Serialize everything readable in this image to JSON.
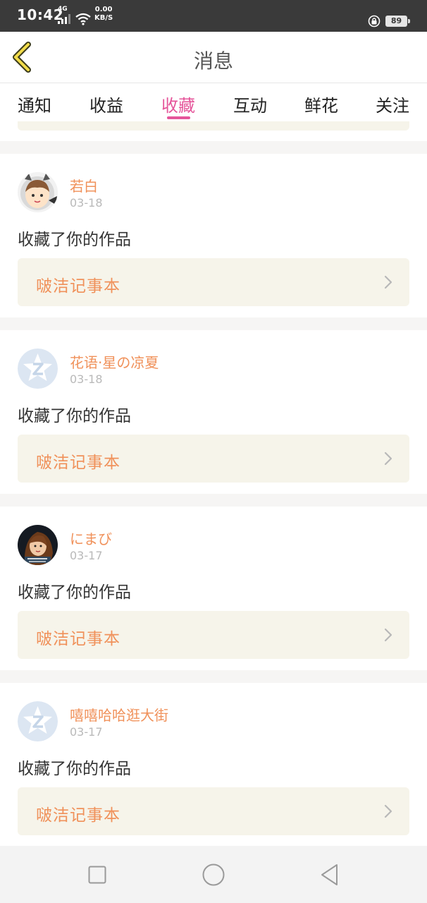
{
  "status_bar": {
    "time": "10:42",
    "network": "4G",
    "speed_value": "0.00",
    "speed_unit": "KB/S",
    "battery": "89"
  },
  "header": {
    "title": "消息"
  },
  "tabs": [
    {
      "label": "通知",
      "active": false
    },
    {
      "label": "收益",
      "active": false
    },
    {
      "label": "收藏",
      "active": true
    },
    {
      "label": "互动",
      "active": false
    },
    {
      "label": "鲜花",
      "active": false
    },
    {
      "label": "关注",
      "active": false
    }
  ],
  "messages": [
    {
      "user": "若白",
      "date": "03-18",
      "action": "收藏了你的作品",
      "work": "啵洁记事本",
      "avatar": "cartoon-avatar"
    },
    {
      "user": "花语·星の凉夏",
      "date": "03-18",
      "action": "收藏了你的作品",
      "work": "啵洁记事本",
      "avatar": "default-star-avatar"
    },
    {
      "user": "にまび",
      "date": "03-17",
      "action": "收藏了你的作品",
      "work": "啵洁记事本",
      "avatar": "princess-avatar"
    },
    {
      "user": "嘻嘻哈哈逛大街",
      "date": "03-17",
      "action": "收藏了你的作品",
      "work": "啵洁记事本",
      "avatar": "default-star-avatar"
    }
  ],
  "colors": {
    "accent": "#e5559a",
    "name": "#f0915a",
    "work_bg": "#f6f4ea"
  },
  "navbar": {
    "icons": [
      "square-icon",
      "circle-icon",
      "triangle-back-icon"
    ]
  }
}
